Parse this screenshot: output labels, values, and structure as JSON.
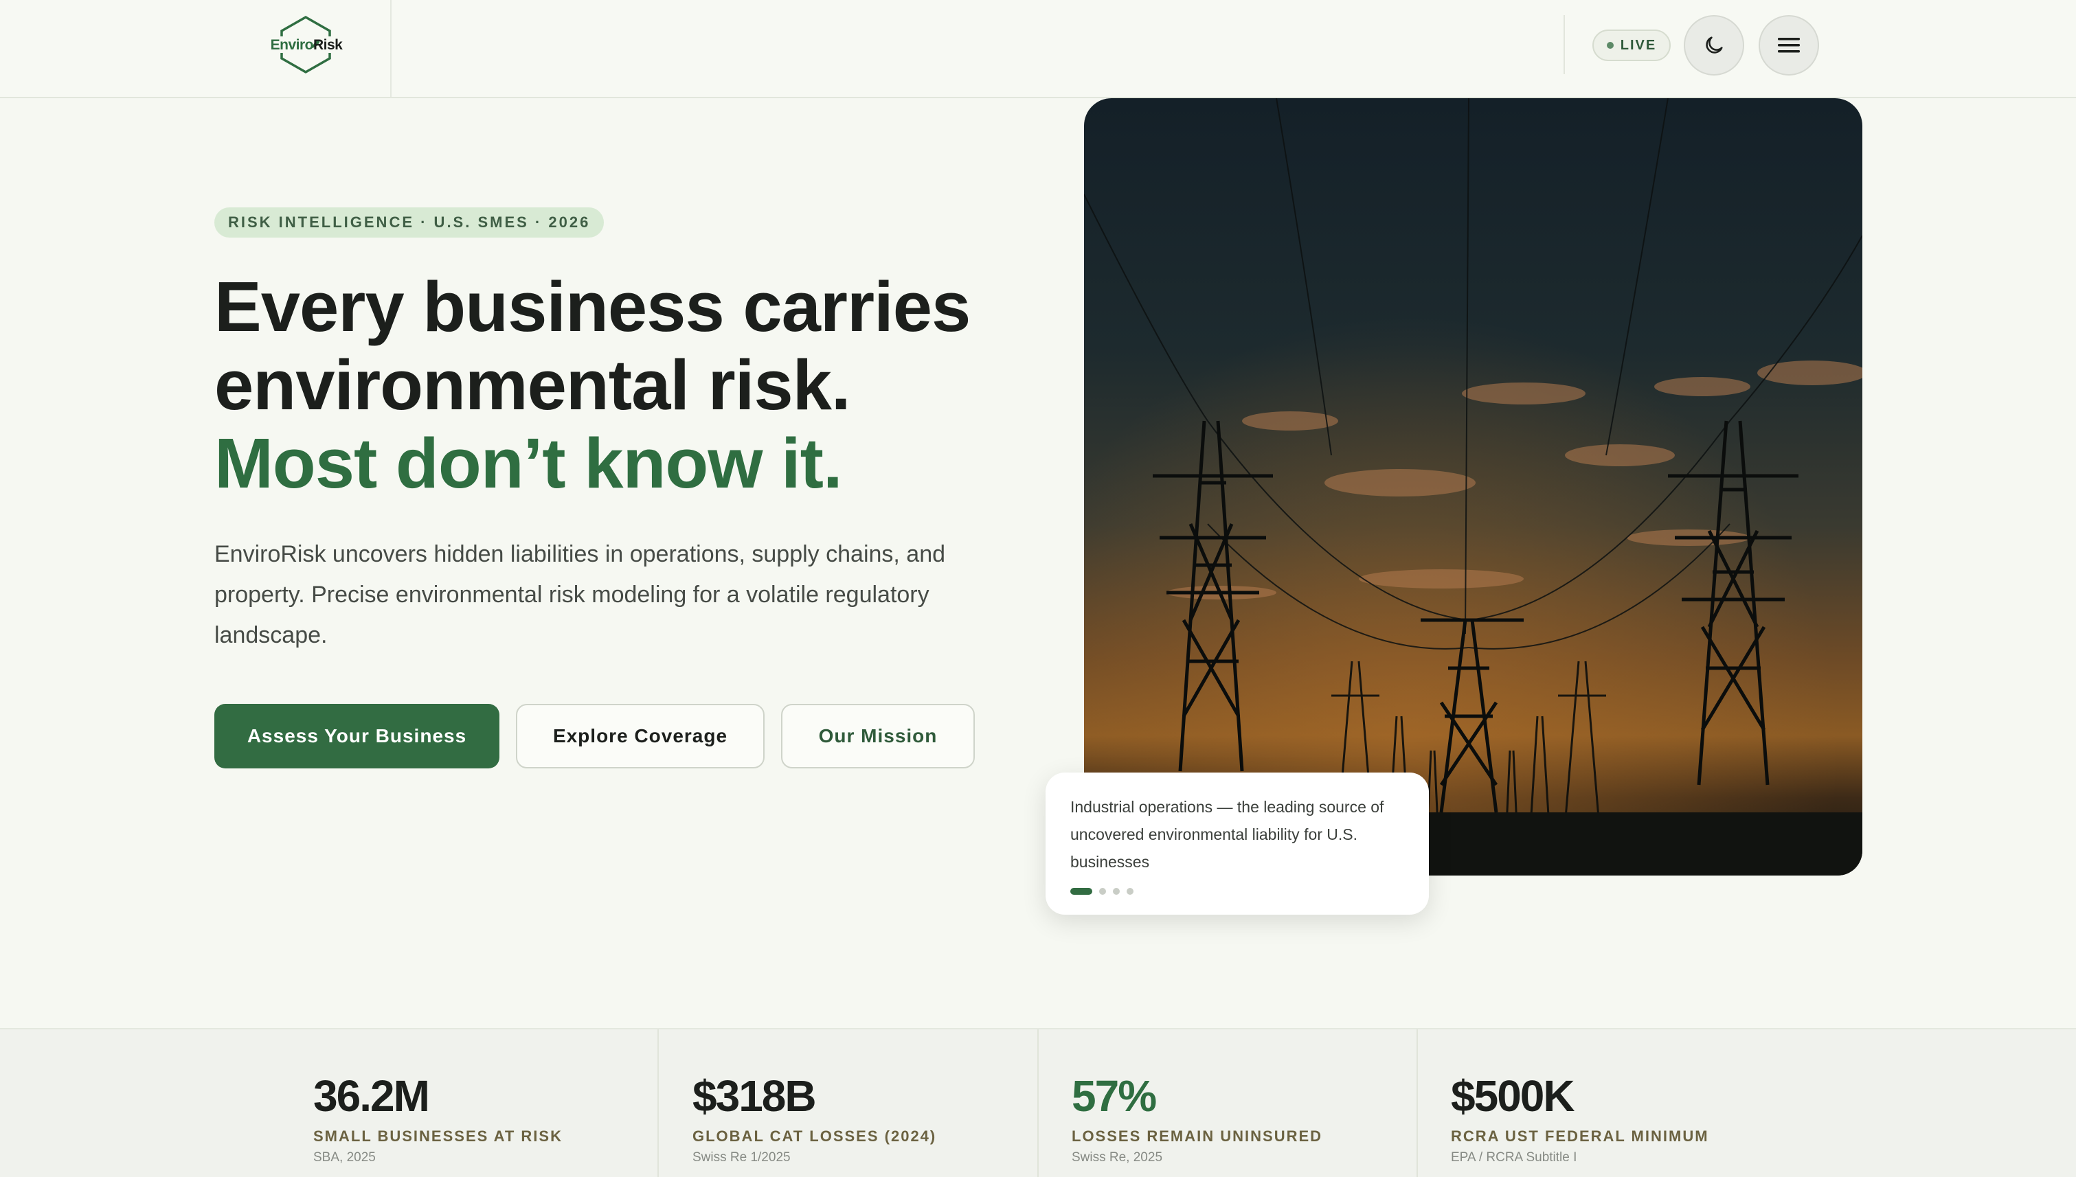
{
  "header": {
    "logo": {
      "part1": "Enviro",
      "part2": "Risk"
    },
    "live_label": "LIVE",
    "theme_toggle_icon": "moon-icon",
    "menu_icon": "hamburger-menu-icon"
  },
  "hero": {
    "eyebrow": "RISK INTELLIGENCE · U.S. SMES · 2026",
    "headline_line1": "Every business carries",
    "headline_line2": "environmental risk.",
    "headline_accent": "Most don’t know it.",
    "lede": "EnviroRisk uncovers hidden liabilities in operations, supply chains, and property. Precise environmental risk modeling for a volatile regulatory landscape.",
    "buttons": {
      "primary": "Assess Your Business",
      "secondary": "Explore Coverage",
      "tertiary": "Our Mission"
    },
    "image_alt": "Power transmission towers silhouetted at dusk",
    "caption": "Industrial operations — the leading source of uncovered environmental liability for U.S. businesses",
    "carousel": {
      "total": 4,
      "active": 1
    }
  },
  "stats": [
    {
      "value": "36.2M",
      "label": "SMALL BUSINESSES AT RISK",
      "source": "SBA, 2025",
      "accent": false
    },
    {
      "value": "$318B",
      "label": "GLOBAL CAT LOSSES (2024)",
      "source": "Swiss Re 1/2025",
      "accent": false
    },
    {
      "value": "57%",
      "label": "LOSSES REMAIN UNINSURED",
      "source": "Swiss Re, 2025",
      "accent": true
    },
    {
      "value": "$500K",
      "label": "RCRA UST FEDERAL MINIMUM",
      "source": "EPA / RCRA Subtitle I",
      "accent": false
    }
  ],
  "colors": {
    "brand_green": "#326c42",
    "accent_green": "#2f6e41",
    "page_bg": "#f6f8f2",
    "label_olive": "#6b6241"
  }
}
